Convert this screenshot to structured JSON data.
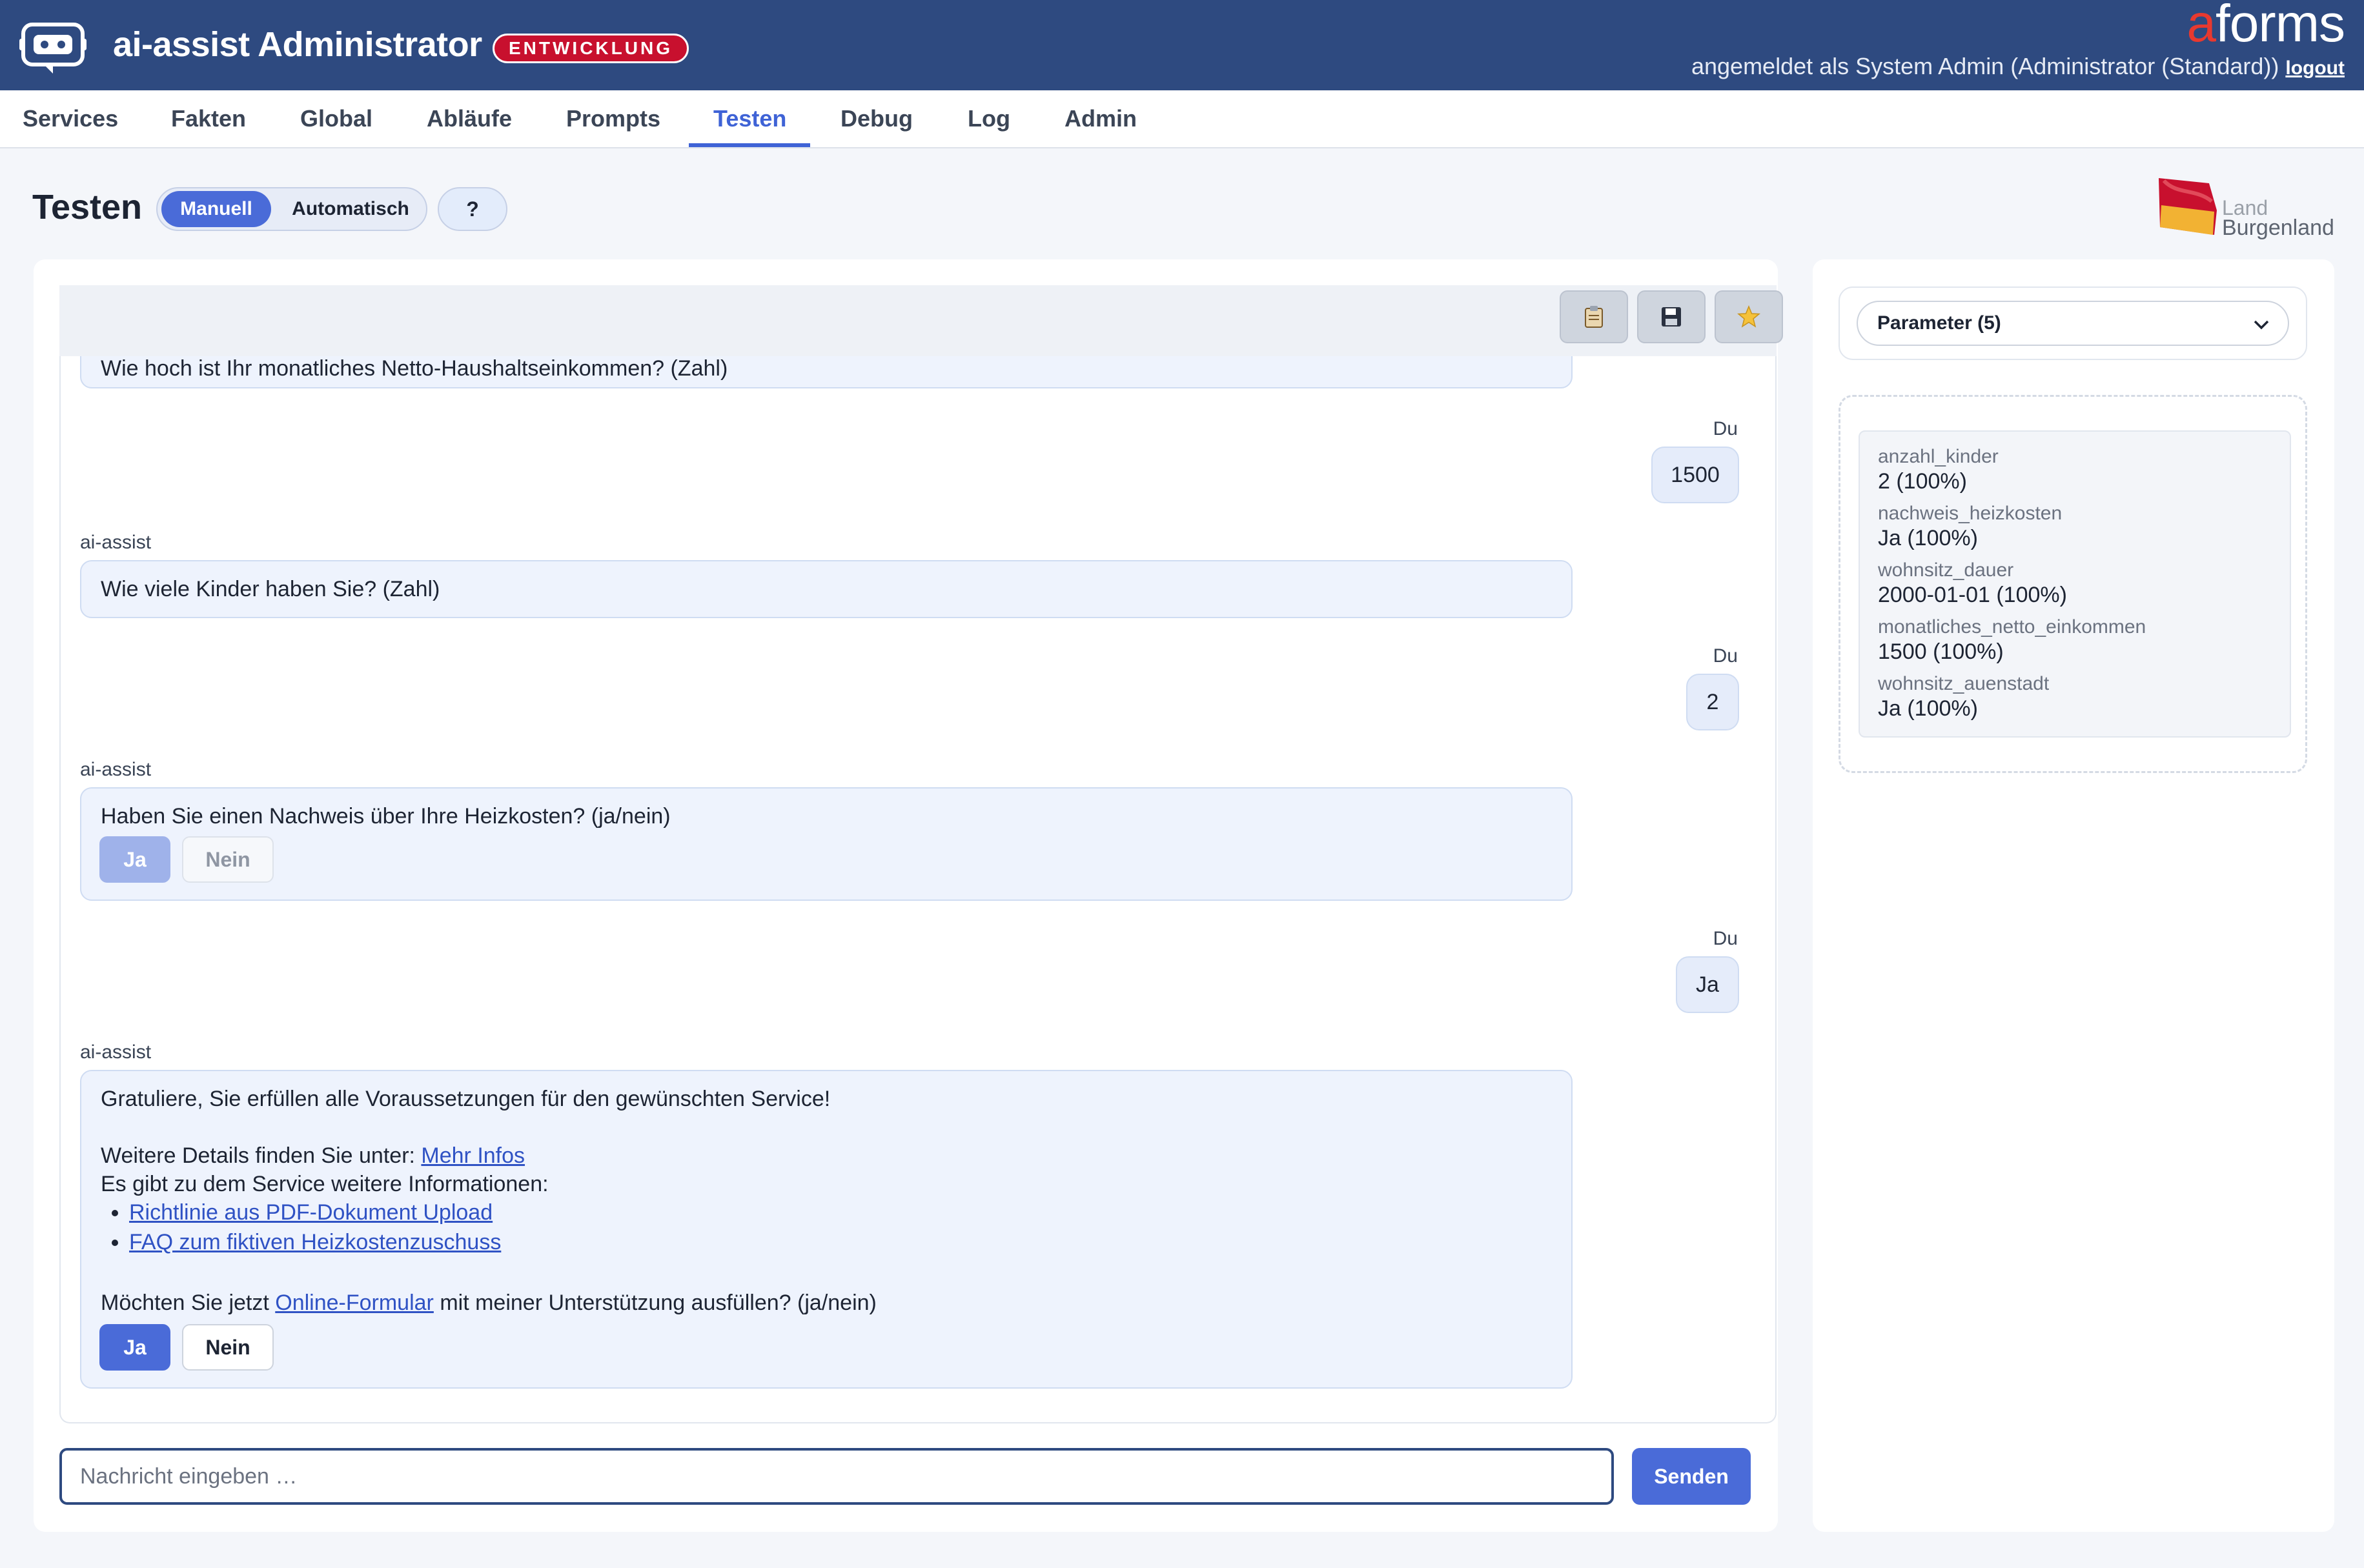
{
  "header": {
    "app_title": "ai-assist Administrator",
    "env_badge": "ENTWICKLUNG",
    "brand_accent": "a",
    "brand_rest": "forms",
    "login_text": "angemeldet als System Admin (Administrator (Standard))",
    "logout_label": "logout"
  },
  "nav": {
    "items": [
      "Services",
      "Fakten",
      "Global",
      "Abläufe",
      "Prompts",
      "Testen",
      "Debug",
      "Log",
      "Admin"
    ],
    "active": "Testen"
  },
  "page": {
    "title": "Testen",
    "mode_manual": "Manuell",
    "mode_auto": "Automatisch",
    "help_label": "?",
    "state_logo_line1": "Land",
    "state_logo_line2": "Burgenland"
  },
  "toolbar": {
    "icons": [
      "clipboard-icon",
      "save-icon",
      "star-icon"
    ]
  },
  "chat": {
    "bot_name": "ai-assist",
    "user_name": "Du",
    "msg0_partial": "Wie hoch ist Ihr monatliches Netto-Haushaltseinkommen? (Zahl)",
    "user_reply1": "1500",
    "msg1": "Wie viele Kinder haben Sie? (Zahl)",
    "user_reply2": "2",
    "msg2": "Haben Sie einen Nachweis über Ihre Heizkosten? (ja/nein)",
    "msg2_yes": "Ja",
    "msg2_no": "Nein",
    "user_reply3": "Ja",
    "msg3_line1": "Gratuliere, Sie erfüllen alle Voraussetzungen für den gewünschten Service!",
    "msg3_details_prefix": "Weitere Details finden Sie unter: ",
    "msg3_details_link": "Mehr Infos",
    "msg3_more_info": "Es gibt zu dem Service weitere Informationen:",
    "msg3_links": [
      "Richtlinie aus PDF-Dokument Upload",
      "FAQ zum fiktiven Heizkostenzuschuss"
    ],
    "msg3_question_prefix": "Möchten Sie jetzt ",
    "msg3_question_link": "Online-Formular",
    "msg3_question_suffix": " mit meiner Unterstützung ausfüllen? (ja/nein)",
    "msg3_yes": "Ja",
    "msg3_no": "Nein"
  },
  "input": {
    "placeholder": "Nachricht eingeben …",
    "value": "",
    "send_label": "Senden"
  },
  "params": {
    "select_label": "Parameter (5)",
    "facts": [
      {
        "key": "anzahl_kinder",
        "value": "2 (100%)"
      },
      {
        "key": "nachweis_heizkosten",
        "value": "Ja (100%)"
      },
      {
        "key": "wohnsitz_dauer",
        "value": "2000-01-01 (100%)"
      },
      {
        "key": "monatliches_netto_einkommen",
        "value": "1500 (100%)"
      },
      {
        "key": "wohnsitz_auenstadt",
        "value": "Ja (100%)"
      }
    ]
  },
  "colors": {
    "header_bg": "#2e4a80",
    "accent": "#4a6bd8",
    "active_nav": "#3f63d6",
    "badge_red": "#c8102e"
  }
}
